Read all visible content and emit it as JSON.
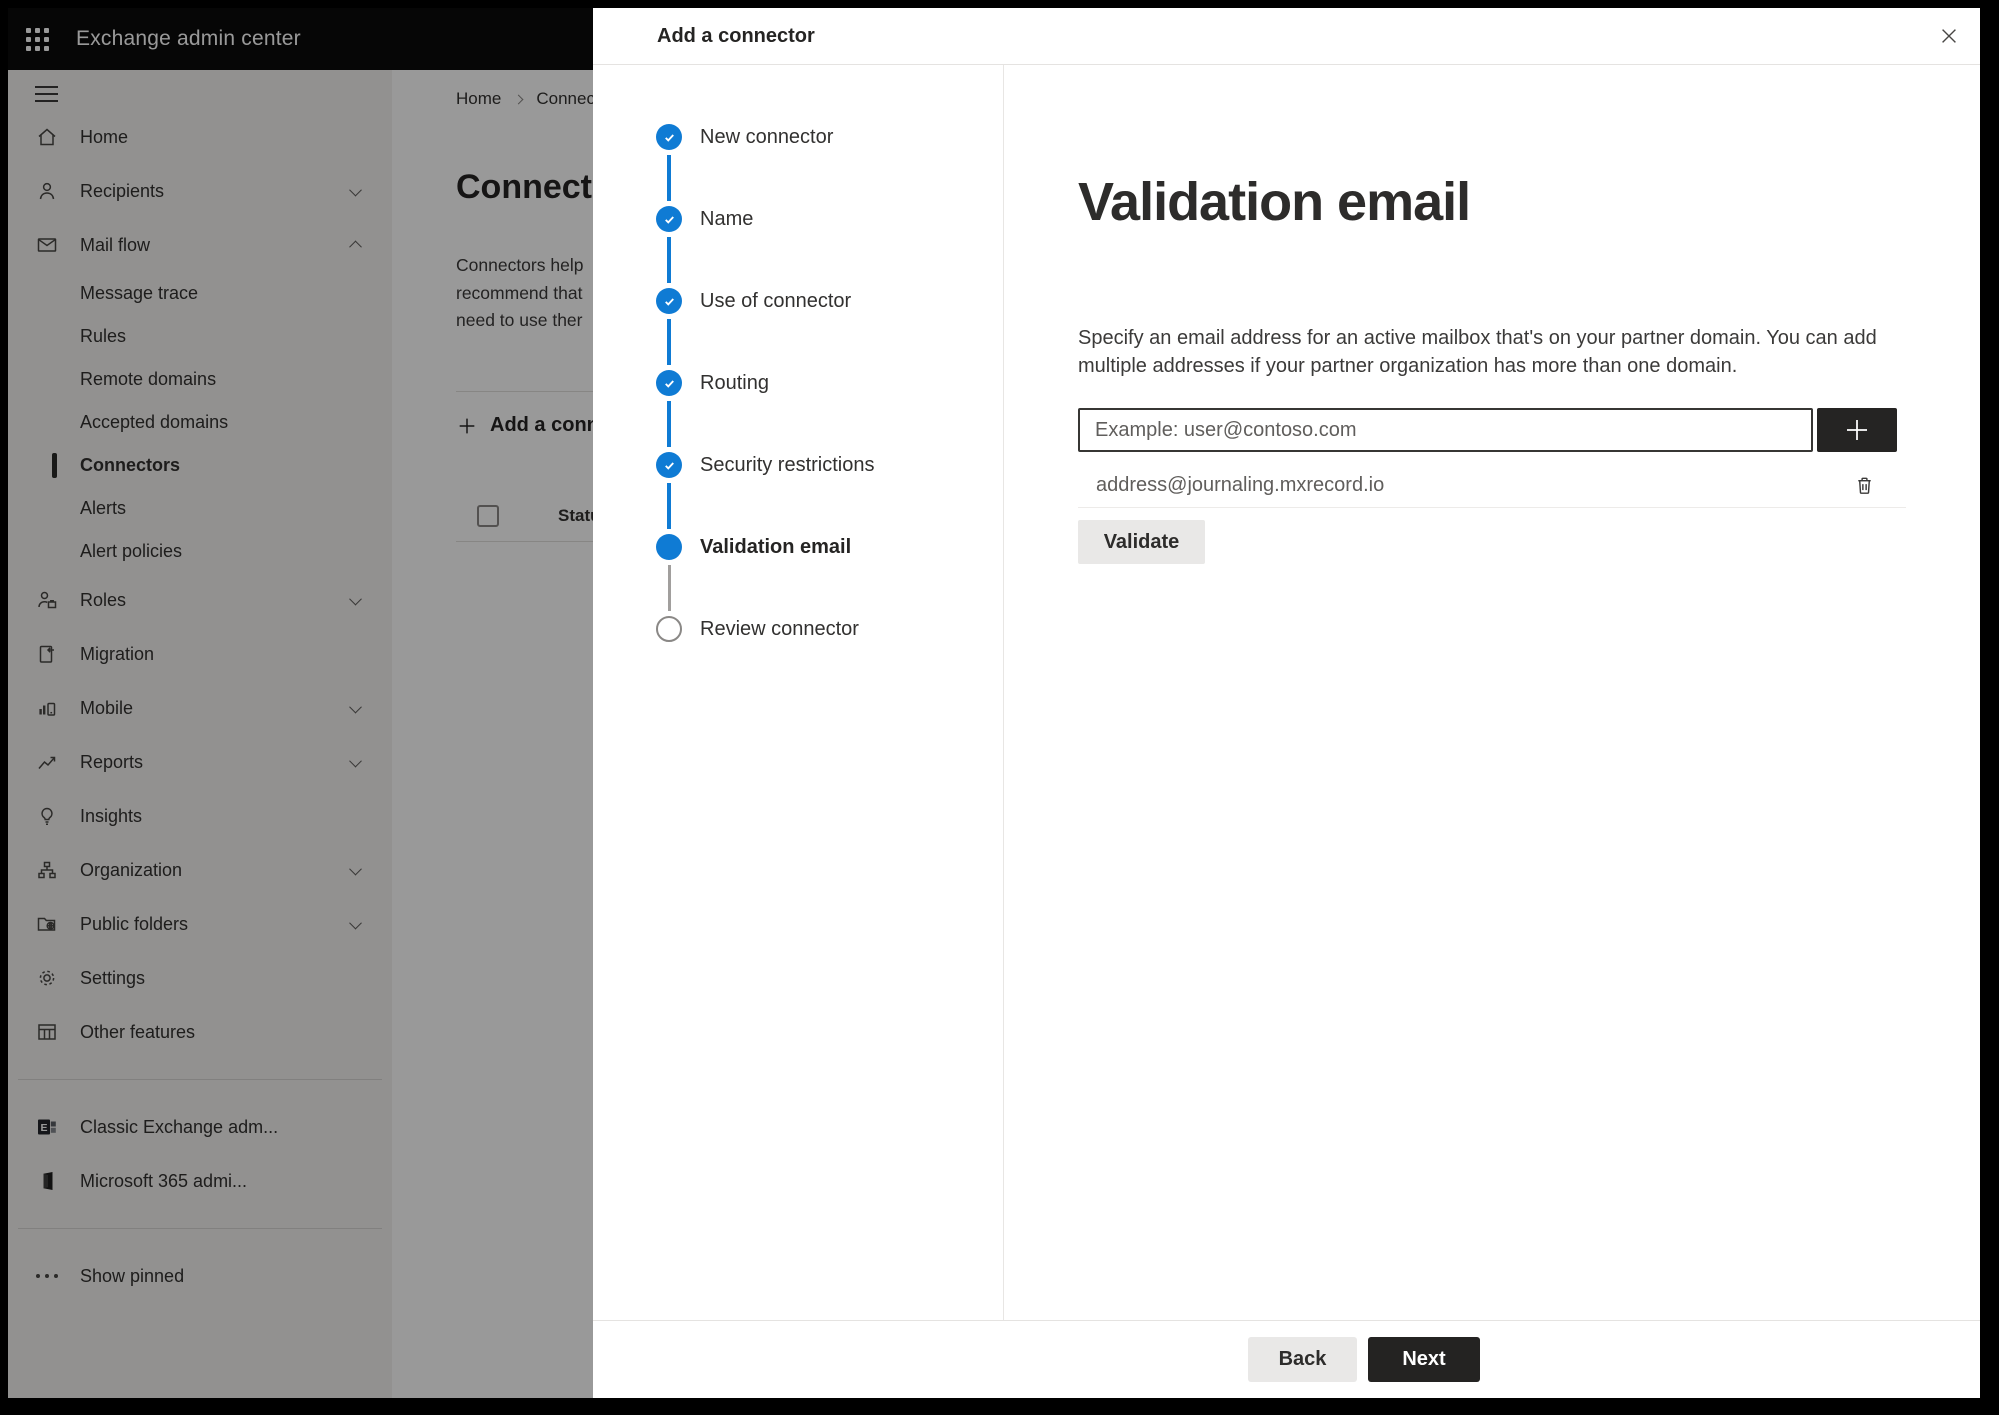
{
  "topbar": {
    "app_launcher_icon": "waffle-icon",
    "title": "Exchange admin center"
  },
  "sidebar": {
    "hamburger_icon": "hamburger-icon",
    "items": [
      {
        "label": "Home",
        "icon": "home-icon"
      },
      {
        "label": "Recipients",
        "icon": "person-icon",
        "chevron": "down"
      },
      {
        "label": "Mail flow",
        "icon": "mail-icon",
        "chevron": "up",
        "expanded": true
      },
      {
        "label": "Message trace"
      },
      {
        "label": "Rules"
      },
      {
        "label": "Remote domains"
      },
      {
        "label": "Accepted domains"
      },
      {
        "label": "Connectors",
        "selected": true
      },
      {
        "label": "Alerts"
      },
      {
        "label": "Alert policies"
      },
      {
        "label": "Roles",
        "icon": "roles-icon",
        "chevron": "down"
      },
      {
        "label": "Migration",
        "icon": "migration-icon"
      },
      {
        "label": "Mobile",
        "icon": "mobile-chart-icon",
        "chevron": "down"
      },
      {
        "label": "Reports",
        "icon": "line-chart-icon",
        "chevron": "down"
      },
      {
        "label": "Insights",
        "icon": "lightbulb-icon"
      },
      {
        "label": "Organization",
        "icon": "org-chart-icon",
        "chevron": "down"
      },
      {
        "label": "Public folders",
        "icon": "folder-globe-icon",
        "chevron": "down"
      },
      {
        "label": "Settings",
        "icon": "gear-icon"
      },
      {
        "label": "Other features",
        "icon": "table-grid-icon"
      }
    ],
    "footer_items": [
      {
        "label": "Classic Exchange adm...",
        "icon": "exchange-logo-icon"
      },
      {
        "label": "Microsoft 365 admi...",
        "icon": "microsoft-365-logo-icon"
      }
    ],
    "show_pinned": {
      "label": "Show pinned",
      "icon": "ellipsis-icon"
    }
  },
  "page": {
    "breadcrumb": {
      "home": "Home",
      "current": "Connectors"
    },
    "title": "Connectors",
    "intro_lines": [
      "Connectors help",
      "recommend that",
      "need to use ther"
    ],
    "add_connector_button": "Add a connector",
    "table": {
      "status_column": "Status"
    }
  },
  "dialog": {
    "title": "Add a connector",
    "close_icon": "close-icon",
    "steps": [
      {
        "label": "New connector",
        "state": "completed"
      },
      {
        "label": "Name",
        "state": "completed"
      },
      {
        "label": "Use of connector",
        "state": "completed"
      },
      {
        "label": "Routing",
        "state": "completed"
      },
      {
        "label": "Security restrictions",
        "state": "completed"
      },
      {
        "label": "Validation email",
        "state": "current"
      },
      {
        "label": "Review connector",
        "state": "upcoming"
      }
    ],
    "content": {
      "heading": "Validation email",
      "description_line1": "Specify an email address for an active mailbox that's on your partner domain. You can add",
      "description_line2": "multiple addresses if your partner organization has more than one domain.",
      "email_input": {
        "value": "",
        "placeholder": "Example: user@contoso.com"
      },
      "add_email_icon": "plus-icon",
      "added_email": "address@journaling.mxrecord.io",
      "delete_email_icon": "trash-icon",
      "validate_button": "Validate"
    },
    "footer": {
      "back_button": "Back",
      "next_button": "Next"
    }
  },
  "colors": {
    "accent": "#0f7bd4",
    "topbar": "#0a0a0a",
    "overlay": "rgba(0,0,0,0.40)"
  }
}
